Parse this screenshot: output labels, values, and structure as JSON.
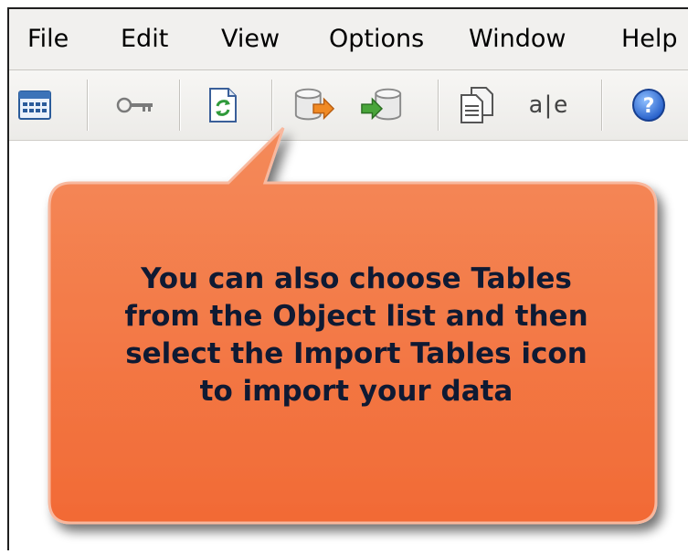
{
  "menubar": {
    "items": [
      "File",
      "Edit",
      "View",
      "Options",
      "Window",
      "Help"
    ]
  },
  "toolbar": {
    "icons": [
      "calendar-grid-icon",
      "key-icon",
      "refresh-document-icon",
      "database-export-icon",
      "database-import-icon",
      "copy-document-icon",
      "rename-text-icon",
      "help-icon"
    ],
    "rename_glyph": "a|e"
  },
  "callout": {
    "text": "You can also choose Tables\nfrom the Object list and then\nselect the Import Tables icon\nto import your data",
    "fill_color": "#f57c4a",
    "border_color": "#f6b39a"
  }
}
